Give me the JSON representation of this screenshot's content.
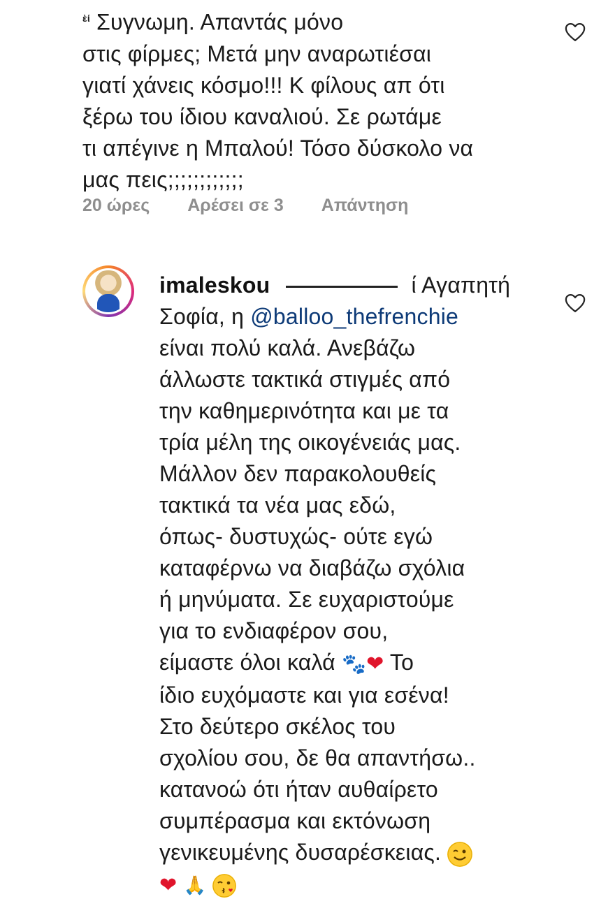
{
  "comment1": {
    "lines": [
      "Συγνωμη. Απαντάς μόνο",
      "στις φίρμες; Μετά μην αναρωτιέσαι",
      "γιατί χάνεις κόσμο!!! Κ φίλους απ ότι",
      "ξέρω του ίδιου καναλιού. Σε ρωτάμε",
      "τι απέγινε η Μπαλού! Τόσο δύσκολο να",
      "μας πεις;;;;;;;;;;;;"
    ],
    "censor_suffix": "ὲί",
    "time": "20 ώρες",
    "likes": "Αρέσει σε 3",
    "reply": "Απάντηση"
  },
  "comment2": {
    "username": "imaleskou",
    "first_line_tail": "ί Αγαπητή",
    "second_line_prefix": "Σοφία, η",
    "mention": "@balloo_thefrenchie",
    "lines": [
      "είναι πολύ καλά. Ανεβάζω",
      "άλλωστε τακτικά στιγμές από",
      "την καθημερινότητα και με τα",
      "τρία μέλη της οικογένειάς μας.",
      "Μάλλον δεν παρακολουθείς",
      "τακτικά τα νέα μας εδώ,",
      "όπως- δυστυχώς- ούτε εγώ",
      "καταφέρνω να διαβάζω σχόλια",
      "ή μηνύματα. Σε ευχαριστούμε",
      "για το ενδιαφέρον σου,"
    ],
    "emoji_line_text": "είμαστε όλοι καλά",
    "emoji_line_tail": "Το",
    "lines2": [
      "ίδιο ευχόμαστε και για εσένα!",
      "Στο δεύτερο σκέλος του",
      "σχολίου σου, δε θα απαντήσω..",
      "κατανοώ ότι ήταν αυθαίρετο",
      "συμπέρασμα και εκτόνωση"
    ],
    "last_text_line": "γενικευμένης δυσαρέσκειας."
  },
  "icons": {
    "like": "heart-outline-icon",
    "heart_emoji": "❤",
    "paw_emoji": "🐾",
    "pray_emoji": "🙏"
  }
}
